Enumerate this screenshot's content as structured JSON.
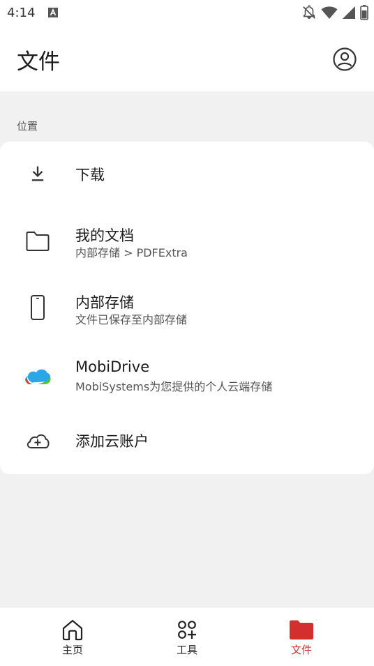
{
  "status_bar": {
    "time": "4:14",
    "icons": [
      "text-a-icon",
      "bell-off-icon",
      "wifi-icon",
      "signal-icon",
      "battery-icon"
    ]
  },
  "header": {
    "title": "文件",
    "account_icon": "account-circle-icon"
  },
  "locations": {
    "section_label": "位置",
    "items": [
      {
        "title": "下载",
        "icon": "download-icon"
      },
      {
        "title": "我的文档",
        "subtitle": "内部存储 > PDFExtra",
        "icon": "folder-icon"
      },
      {
        "title": "内部存储",
        "subtitle": "文件已保存至内部存储",
        "icon": "phone-icon"
      },
      {
        "title": "MobiDrive",
        "subtitle": "MobiSystems为您提供的个人云端存储",
        "icon": "mobidrive-logo-icon"
      },
      {
        "title": "添加云账户",
        "icon": "cloud-add-icon"
      }
    ]
  },
  "bottom_nav": {
    "items": [
      {
        "label": "主页",
        "icon": "home-icon",
        "active": false
      },
      {
        "label": "工具",
        "icon": "tools-icon",
        "active": false
      },
      {
        "label": "文件",
        "icon": "folder-filled-icon",
        "active": true
      }
    ],
    "active_color": "#d32f2f",
    "inactive_color": "#222222"
  }
}
